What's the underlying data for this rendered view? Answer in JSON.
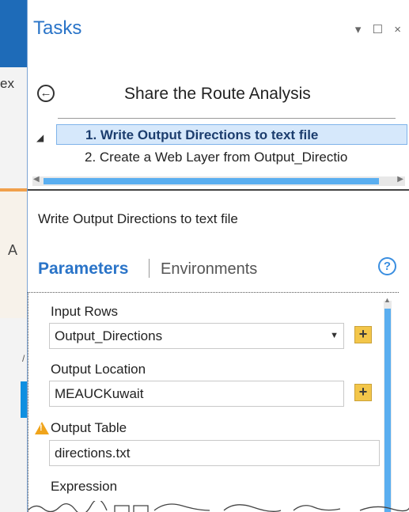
{
  "background": {
    "partial_text": "ex",
    "partial_letter": "A",
    "tick_mark": "/"
  },
  "pane": {
    "title": "Tasks",
    "controls": {
      "pin": "▾",
      "maximize": "☐",
      "close": "×"
    }
  },
  "task": {
    "title": "Share the Route Analysis",
    "steps": [
      {
        "label": "1.  Write Output Directions to text file"
      },
      {
        "label": "2.  Create a Web Layer from Output_Directio"
      }
    ]
  },
  "step_heading": "Write Output Directions to text file",
  "tabs": {
    "parameters": "Parameters",
    "environments": "Environments",
    "help": "?"
  },
  "parameters": {
    "input_rows": {
      "label": "Input Rows",
      "value": "Output_Directions"
    },
    "output_location": {
      "label": "Output Location",
      "value": "MEAUCKuwait"
    },
    "output_table": {
      "label": "Output Table",
      "value": "directions.txt"
    },
    "expression": {
      "label": "Expression"
    }
  },
  "colors": {
    "accent": "#2a74c8",
    "selection": "#d6e8fb",
    "scroll_thumb": "#5aaef0",
    "warning": "#f0a41b"
  }
}
